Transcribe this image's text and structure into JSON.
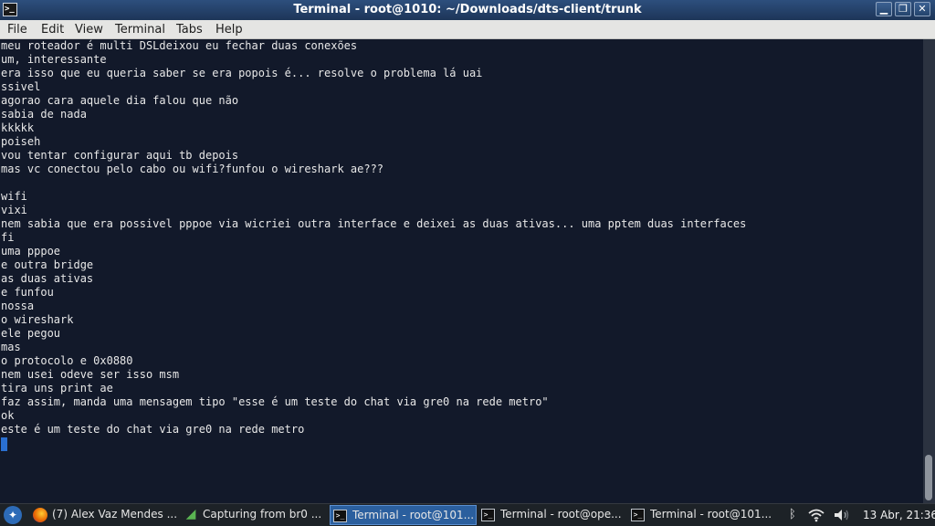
{
  "window": {
    "title": "Terminal - root@1010: ~/Downloads/dts-client/trunk",
    "app_icon": "terminal-icon",
    "buttons": {
      "minimize": "▁",
      "maximize": "❐",
      "close": "✕"
    }
  },
  "menu": {
    "items": [
      "File",
      "Edit",
      "View",
      "Terminal",
      "Tabs",
      "Help"
    ]
  },
  "terminal": {
    "lines": [
      "meu roteador é multi DSLdeixou eu fechar duas conexões",
      "um, interessante",
      "era isso que eu queria saber se era popois é... resolve o problema lá uai",
      "ssivel",
      "agorao cara aquele dia falou que não",
      "sabia de nada",
      "kkkkk",
      "poiseh",
      "vou tentar configurar aqui tb depois",
      "mas vc conectou pelo cabo ou wifi?funfou o wireshark ae???",
      "",
      "wifi",
      "vixi",
      "nem sabia que era possivel pppoe via wicriei outra interface e deixei as duas ativas... uma pptem duas interfaces",
      "fi",
      "uma pppoe",
      "e outra bridge",
      "as duas ativas",
      "e funfou",
      "nossa",
      "o wireshark",
      "ele pegou",
      "mas",
      "o protocolo e 0x0880",
      "nem usei odeve ser isso msm",
      "tira uns print ae",
      "faz assim, manda uma mensagem tipo \"esse é um teste do chat via gre0 na rede metro\"",
      "ok",
      "este é um teste do chat via gre0 na rede metro"
    ],
    "cursor_color": "#2a6fd1",
    "background": "#12192a",
    "foreground": "#e8e8e8"
  },
  "taskbar": {
    "start_icon": "distro-logo-icon",
    "tasks": [
      {
        "label": "(7) Alex Vaz Mendes ...",
        "icon": "firefox-icon",
        "active": false
      },
      {
        "label": "Capturing from br0 ...",
        "icon": "wireshark-icon",
        "active": false
      },
      {
        "label": "Terminal - root@101...",
        "icon": "terminal-icon",
        "active": true
      },
      {
        "label": "Terminal - root@ope...",
        "icon": "terminal-icon",
        "active": false
      },
      {
        "label": "Terminal - root@101...",
        "icon": "terminal-icon",
        "active": false
      }
    ],
    "tray": {
      "icons": [
        "bluetooth-icon",
        "wifi-icon",
        "volume-icon"
      ]
    },
    "clock": "13 Abr, 21:36"
  }
}
